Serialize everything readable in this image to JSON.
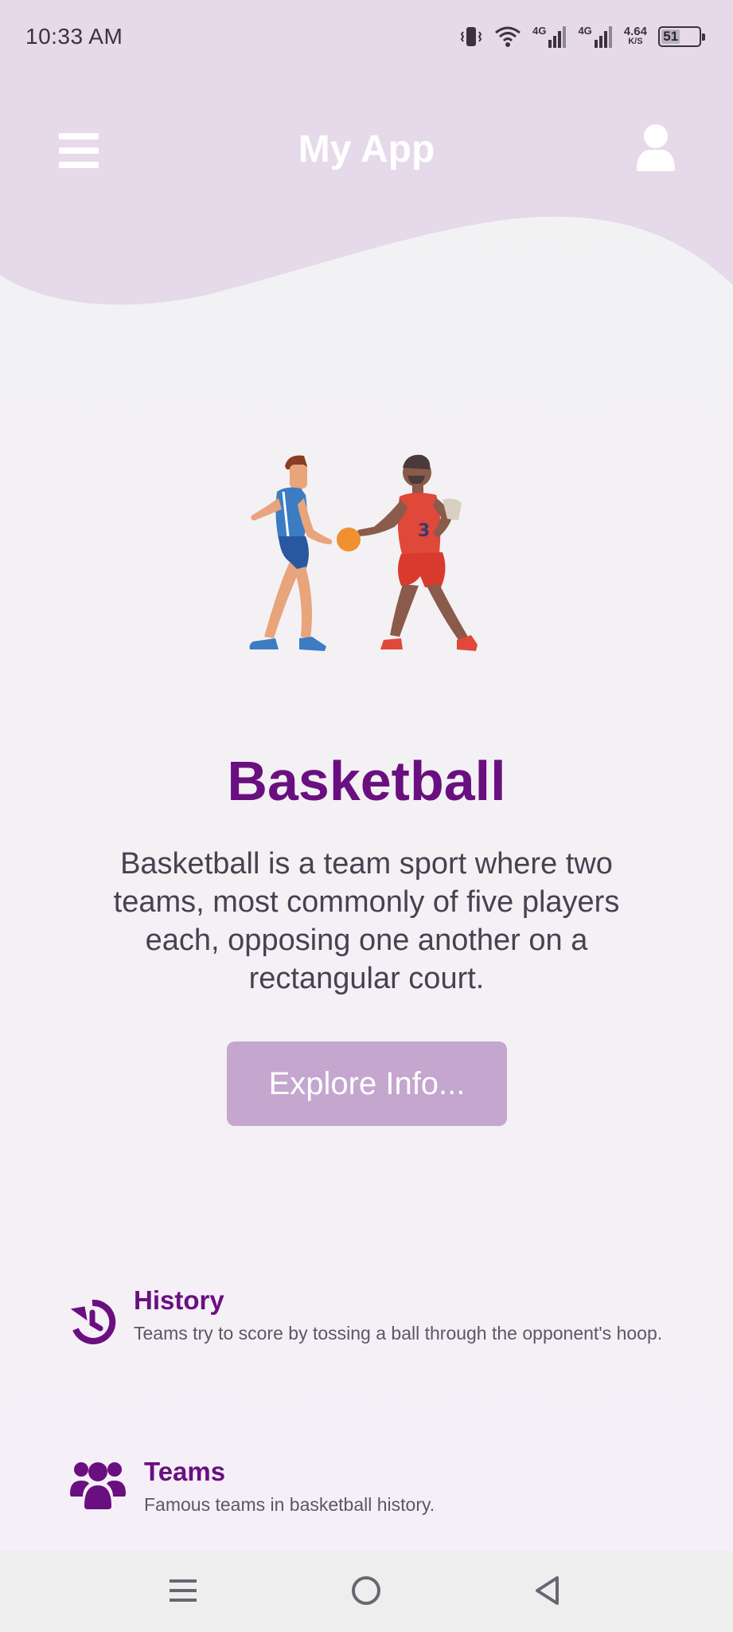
{
  "status_bar": {
    "time": "10:33 AM",
    "network_1": "4G",
    "network_2": "4G",
    "speed_value": "4.64",
    "speed_unit": "K/S",
    "battery_level": "51"
  },
  "app_bar": {
    "title": "My App",
    "menu_icon": "menu-icon",
    "user_icon": "user-icon"
  },
  "main": {
    "title": "Basketball",
    "description": "Basketball is a team sport where two teams, most commonly of five players each, opposing one another on a rectangular court.",
    "explore_button": "Explore Info..."
  },
  "features": [
    {
      "icon": "history-icon",
      "title": "History",
      "description": "Teams try to score by tossing a ball through the opponent's hoop."
    },
    {
      "icon": "teams-icon",
      "title": "Teams",
      "description": "Famous teams in basketball history."
    }
  ],
  "colors": {
    "accent": "#6a0f80",
    "button": "#c4a6cf",
    "header": "#e5d9ea"
  },
  "nav_bar": {
    "items": [
      "recent-apps-icon",
      "home-icon",
      "back-icon"
    ]
  }
}
